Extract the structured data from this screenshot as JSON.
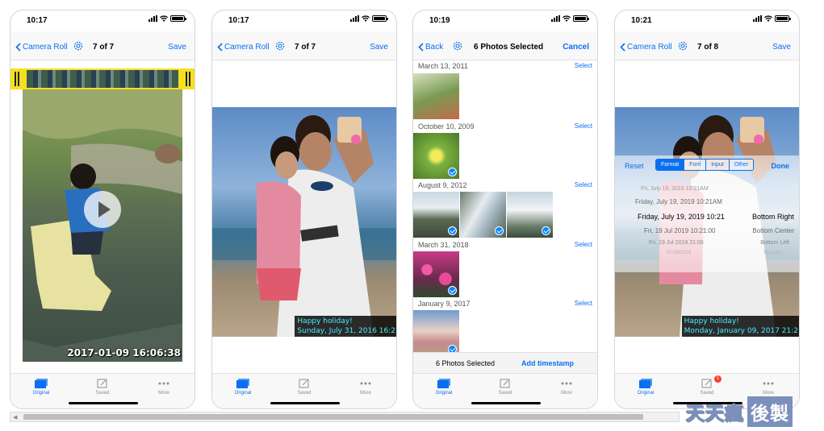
{
  "screens": [
    {
      "status_time": "10:17",
      "nav": {
        "back_label": "Camera Roll",
        "title": "7 of 7",
        "right_label": "Save"
      },
      "timestamp": "2017-01-09 16:06:38",
      "tabs": [
        "Original",
        "Saved",
        "More"
      ]
    },
    {
      "status_time": "10:17",
      "nav": {
        "back_label": "Camera Roll",
        "title": "7 of 7",
        "right_label": "Save"
      },
      "timestamp_line1": "Happy holiday!",
      "timestamp_line2": "Sunday, July 31, 2016 16:2",
      "tabs": [
        "Original",
        "Saved",
        "More"
      ]
    },
    {
      "status_time": "10:19",
      "nav": {
        "back_label": "Back",
        "title": "6 Photos Selected",
        "right_label": "Cancel"
      },
      "sections": [
        {
          "date": "March 13, 2011",
          "select": "Select"
        },
        {
          "date": "October 10, 2009",
          "select": "Select"
        },
        {
          "date": "August 9, 2012",
          "select": "Select"
        },
        {
          "date": "March 31, 2018",
          "select": "Select"
        },
        {
          "date": "January 9, 2017",
          "select": "Select"
        }
      ],
      "bottom": {
        "count": "6 Photos Selected",
        "action": "Add timestamp"
      },
      "tabs": [
        "Original",
        "Saved",
        "More"
      ]
    },
    {
      "status_time": "10:21",
      "nav": {
        "back_label": "Camera Roll",
        "title": "7 of 8",
        "right_label": "Save"
      },
      "overlay": {
        "reset": "Reset",
        "segments": [
          "Format",
          "Font",
          "Input",
          "Other"
        ],
        "done": "Done",
        "rows": [
          {
            "left": "Fri, July 19, 2019 10:21AM",
            "right": ""
          },
          {
            "left": "Friday, July 19, 2019 10:21AM",
            "right": ""
          },
          {
            "left": "Friday, July 19, 2019 10:21",
            "right": "Bottom Right"
          },
          {
            "left": "Fri, 19 Jul 2019 10:21:00",
            "right": "Bottom Center"
          },
          {
            "left": "Fri, 19 Jul 2019 21:06",
            "right": "Bottom Left"
          },
          {
            "left": "07/19/2019",
            "right": "You can't"
          }
        ]
      },
      "timestamp_line1": "Happy holiday!",
      "timestamp_line2": "Monday, January 09, 2017 21:2",
      "tabs": [
        "Original",
        "Saved",
        "More"
      ],
      "saved_badge": "1"
    }
  ],
  "watermark": {
    "left_text": "天天瘋",
    "right_text": "後製"
  },
  "colors": {
    "accent": "#0a6ff0",
    "timestamp": "#46f0ff",
    "trim_handle": "#f5e020"
  },
  "icons": [
    "chevron-left-icon",
    "gear-icon",
    "photos-tab-icon",
    "edit-tab-icon",
    "more-tab-icon",
    "play-icon",
    "checkmark-icon"
  ]
}
